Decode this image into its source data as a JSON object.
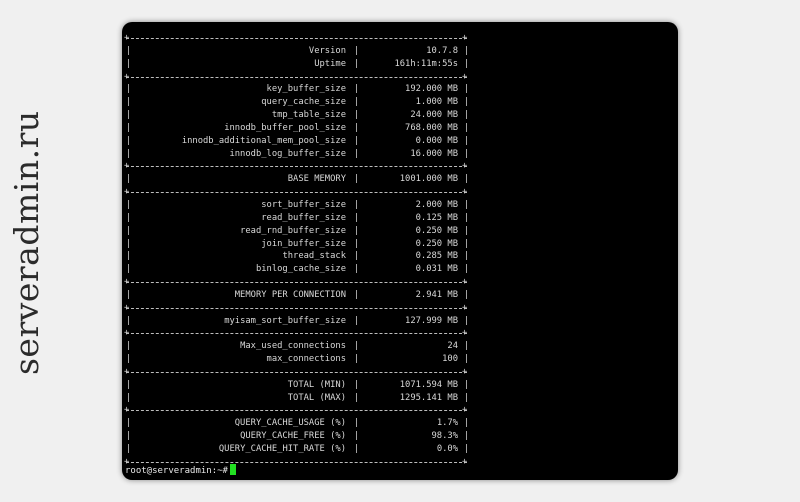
{
  "watermark": "serveradmin.ru",
  "prompt": "root@serveradmin:~#",
  "colors": {
    "terminal_bg": "#000000",
    "text": "#d8d8d8",
    "cursor": "#22e022",
    "page_bg": "#f0f0f0"
  },
  "report": {
    "sections": [
      [
        {
          "label": "Version",
          "value": "10.7.8"
        },
        {
          "label": "Uptime",
          "value": "161h:11m:55s"
        }
      ],
      [
        {
          "label": "key_buffer_size",
          "value": "192.000 MB"
        },
        {
          "label": "query_cache_size",
          "value": "1.000 MB"
        },
        {
          "label": "tmp_table_size",
          "value": "24.000 MB"
        },
        {
          "label": "innodb_buffer_pool_size",
          "value": "768.000 MB"
        },
        {
          "label": "innodb_additional_mem_pool_size",
          "value": "0.000 MB"
        },
        {
          "label": "innodb_log_buffer_size",
          "value": "16.000 MB"
        }
      ],
      [
        {
          "label": "BASE MEMORY",
          "value": "1001.000 MB"
        }
      ],
      [
        {
          "label": "sort_buffer_size",
          "value": "2.000 MB"
        },
        {
          "label": "read_buffer_size",
          "value": "0.125 MB"
        },
        {
          "label": "read_rnd_buffer_size",
          "value": "0.250 MB"
        },
        {
          "label": "join_buffer_size",
          "value": "0.250 MB"
        },
        {
          "label": "thread_stack",
          "value": "0.285 MB"
        },
        {
          "label": "binlog_cache_size",
          "value": "0.031 MB"
        }
      ],
      [
        {
          "label": "MEMORY PER CONNECTION",
          "value": "2.941 MB"
        }
      ],
      [
        {
          "label": "myisam_sort_buffer_size",
          "value": "127.999 MB"
        }
      ],
      [
        {
          "label": "Max_used_connections",
          "value": "24"
        },
        {
          "label": "max_connections",
          "value": "100"
        }
      ],
      [
        {
          "label": "TOTAL (MIN)",
          "value": "1071.594 MB"
        },
        {
          "label": "TOTAL (MAX)",
          "value": "1295.141 MB"
        }
      ],
      [
        {
          "label": "QUERY_CACHE_USAGE (%)",
          "value": "1.7%"
        },
        {
          "label": "QUERY_CACHE_FREE (%)",
          "value": "98.3%"
        },
        {
          "label": "QUERY_CACHE_HIT_RATE (%)",
          "value": "0.0%"
        }
      ]
    ]
  }
}
